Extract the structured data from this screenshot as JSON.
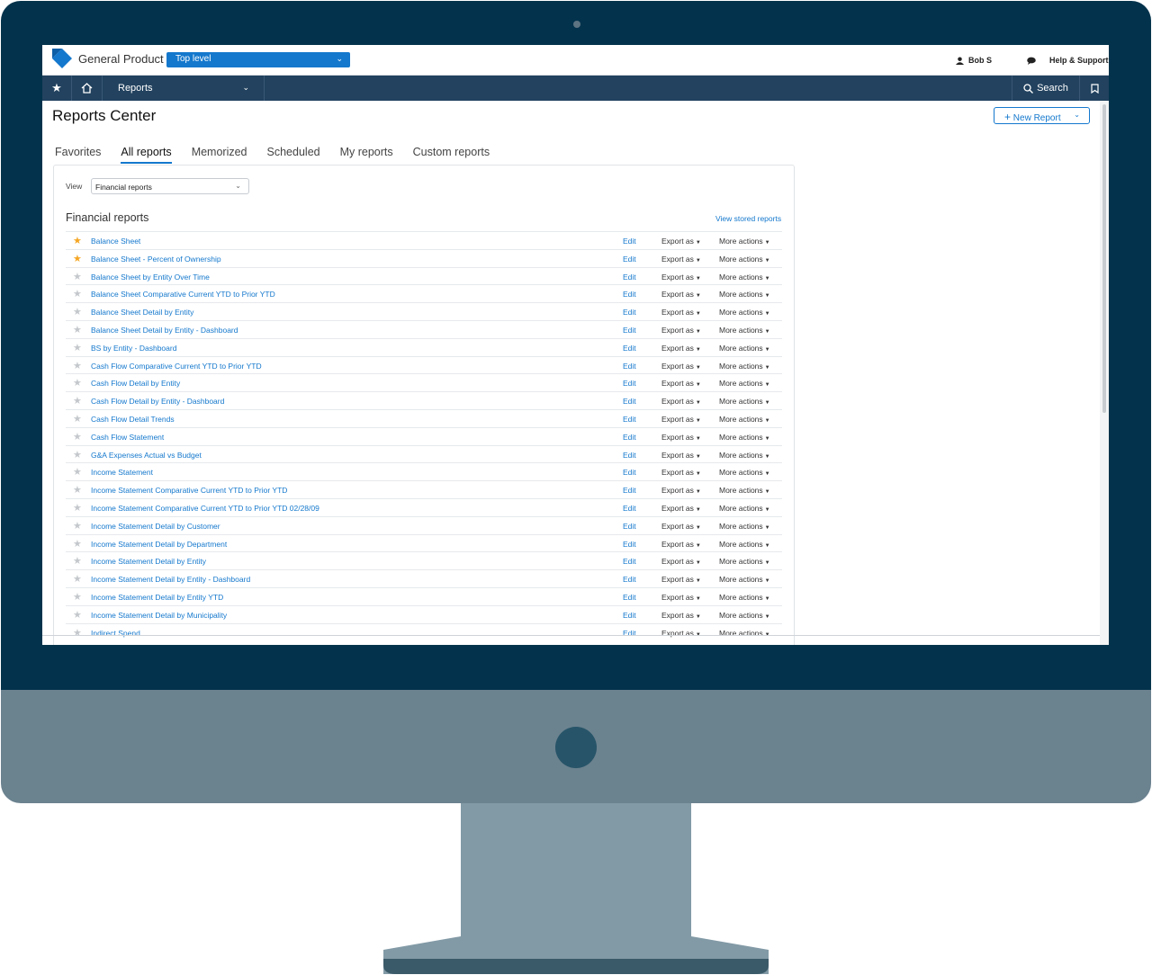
{
  "header": {
    "brand": "General Product",
    "entity_select": "Top level",
    "user": "Bob S",
    "help": "Help & Support"
  },
  "nav": {
    "module": "Reports",
    "search": "Search"
  },
  "page": {
    "title": "Reports Center",
    "new_report": "New Report"
  },
  "tabs": [
    "Favorites",
    "All reports",
    "Memorized",
    "Scheduled",
    "My reports",
    "Custom reports"
  ],
  "active_tab": "All reports",
  "filter": {
    "label": "View",
    "value": "Financial reports"
  },
  "section": {
    "title": "Financial reports",
    "stored_link": "View stored reports"
  },
  "row_actions": {
    "edit": "Edit",
    "export": "Export as",
    "more": "More actions"
  },
  "reports": [
    {
      "name": "Balance Sheet",
      "favorite": true
    },
    {
      "name": "Balance Sheet - Percent of Ownership",
      "favorite": true
    },
    {
      "name": "Balance Sheet by Entity Over Time",
      "favorite": false
    },
    {
      "name": "Balance Sheet Comparative Current YTD to Prior YTD",
      "favorite": false
    },
    {
      "name": "Balance Sheet Detail by Entity",
      "favorite": false
    },
    {
      "name": "Balance Sheet Detail by Entity - Dashboard",
      "favorite": false
    },
    {
      "name": "BS by Entity - Dashboard",
      "favorite": false
    },
    {
      "name": "Cash Flow Comparative Current YTD to Prior YTD",
      "favorite": false
    },
    {
      "name": "Cash Flow Detail by Entity",
      "favorite": false
    },
    {
      "name": "Cash Flow Detail by Entity - Dashboard",
      "favorite": false
    },
    {
      "name": "Cash Flow Detail Trends",
      "favorite": false
    },
    {
      "name": "Cash Flow Statement",
      "favorite": false
    },
    {
      "name": "G&A Expenses Actual vs Budget",
      "favorite": false
    },
    {
      "name": "Income Statement",
      "favorite": false
    },
    {
      "name": "Income Statement Comparative Current YTD to Prior YTD",
      "favorite": false
    },
    {
      "name": "Income Statement Comparative Current YTD to Prior YTD 02/28/09",
      "favorite": false
    },
    {
      "name": "Income Statement Detail by Customer",
      "favorite": false
    },
    {
      "name": "Income Statement Detail by Department",
      "favorite": false
    },
    {
      "name": "Income Statement Detail by Entity",
      "favorite": false
    },
    {
      "name": "Income Statement Detail by Entity - Dashboard",
      "favorite": false
    },
    {
      "name": "Income Statement Detail by Entity YTD",
      "favorite": false
    },
    {
      "name": "Income Statement Detail by Municipality",
      "favorite": false
    },
    {
      "name": "Indirect Spend",
      "favorite": false
    }
  ],
  "colors": {
    "monitor_bezel": "#03334c",
    "monitor_chin": "#6b828f",
    "stand": "#829aa6",
    "nav_bar": "#22425f",
    "accent": "#1478cd",
    "favorite_star": "#f5a623"
  }
}
